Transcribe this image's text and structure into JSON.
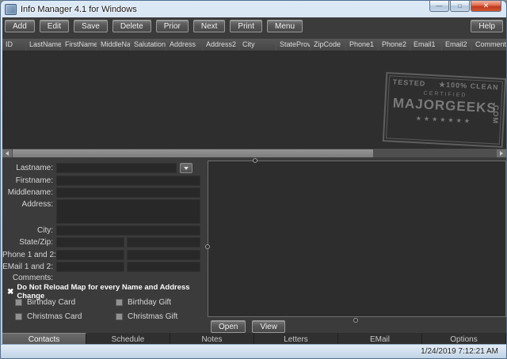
{
  "colors": {
    "frame": "#b9cfe4",
    "client_bg": "#3b3b3b",
    "grid_bg": "#2e2e2e",
    "button_face": "#5a5a5a",
    "close_button": "#c8432b",
    "label_text": "#d6d6d6"
  },
  "window": {
    "title": "Info Manager 4.1 for Windows",
    "controls": {
      "minimize": "—",
      "maximize": "□",
      "close": "✕"
    }
  },
  "toolbar": {
    "buttons": [
      "Add",
      "Edit",
      "Save",
      "Delete",
      "Prior",
      "Next",
      "Print",
      "Menu"
    ],
    "help": "Help"
  },
  "grid": {
    "columns": [
      "ID",
      "LastName",
      "FirstName",
      "MiddleName",
      "Salutation",
      "Address",
      "Address2",
      "City",
      "StateProv",
      "ZipCode",
      "Phone1",
      "Phone2",
      "Email1",
      "Email2",
      "Comments"
    ]
  },
  "watermark": {
    "tested": "TESTED",
    "clean": "★100% CLEAN",
    "certified": "CERTIFIED",
    "brand": "MAJORGEEKS",
    "com": ".COM",
    "stars": "★★★★★★★"
  },
  "form": {
    "labels": [
      "Lastname:",
      "Firstname:",
      "Middlename:",
      "Address:",
      "City:",
      "State/Zip:",
      "Phone 1 and 2:",
      "EMail 1 and 2:",
      "Comments:"
    ],
    "values": {
      "lastname": "",
      "firstname": "",
      "middlename": "",
      "address": "",
      "city": "",
      "state": "",
      "zip": "",
      "phone1": "",
      "phone2": "",
      "email1": "",
      "email2": ""
    },
    "reload_mark": "✖",
    "reload_label": "Do Not Reload Map for every Name and Address Change",
    "options": [
      "Birthday Card",
      "Birthday Gift",
      "Christmas Card",
      "Christmas Gift"
    ]
  },
  "map": {
    "open": "Open",
    "view": "View"
  },
  "tabs": [
    "Contacts",
    "Schedule",
    "Notes",
    "Letters",
    "EMail",
    "Options"
  ],
  "active_tab": "Contacts",
  "statusbar": {
    "datetime": "1/24/2019 7:12:21 AM"
  }
}
